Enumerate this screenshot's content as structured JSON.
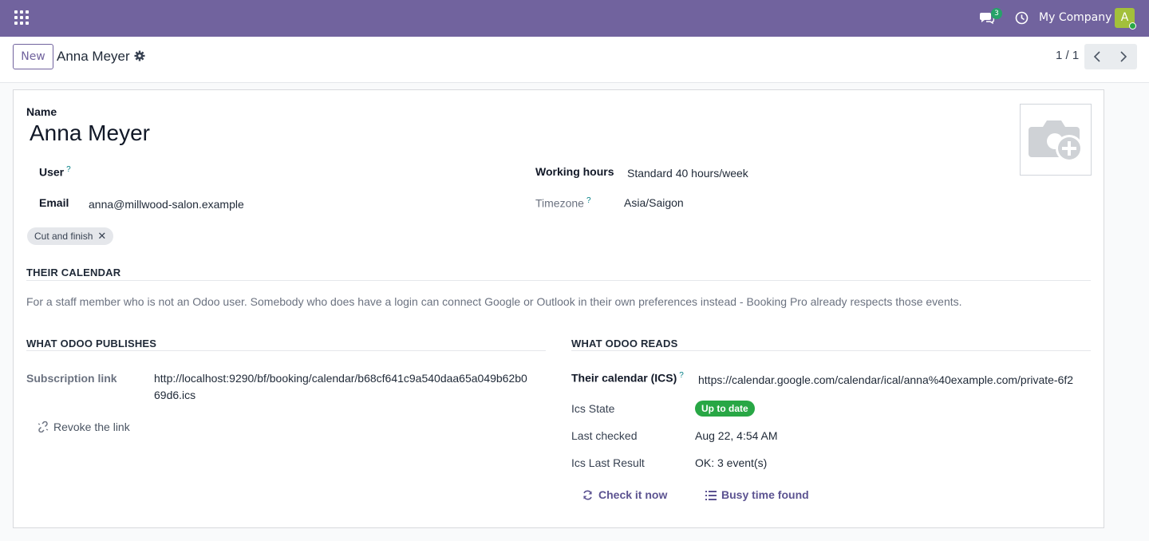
{
  "navbar": {
    "company": "My Company",
    "chat_count": "3",
    "avatar_letter": "A",
    "icons": [
      "apps-icon",
      "chat-icon",
      "clock-icon"
    ]
  },
  "control_panel": {
    "new_label": "New",
    "breadcrumb": "Anna Meyer",
    "pager": "1 / 1"
  },
  "form": {
    "name_label": "Name",
    "name_value": "Anna Meyer",
    "user_label": "User",
    "user_help": "?",
    "email_label": "Email",
    "email_value": "anna@millwood-salon.example",
    "working_hours_label": "Working hours",
    "working_hours_value": "Standard 40 hours/week",
    "timezone_label": "Timezone",
    "timezone_help": "?",
    "timezone_value": "Asia/Saigon",
    "tags": [
      "Cut and finish"
    ],
    "tag_remove": "✕"
  },
  "calendar_section": {
    "title": "THEIR CALENDAR",
    "description": "For a staff member who is not an Odoo user. Somebody who does have a login can connect Google or Outlook in their own preferences instead - Booking Pro already respects those events."
  },
  "publishes": {
    "title": "WHAT ODOO PUBLISHES",
    "subscription_label": "Subscription link",
    "subscription_line1": "http://localhost:9290/bf/booking/calendar/b68cf641c9a540daa65a049b62b0",
    "subscription_line2": "69d6.ics",
    "revoke_label": "Revoke the link"
  },
  "reads": {
    "title": "WHAT ODOO READS",
    "ics_label": "Their calendar (ICS)",
    "ics_help": "?",
    "ics_value": "https://calendar.google.com/calendar/ical/anna%40example.com/private-6f2",
    "state_label": "Ics State",
    "state_value": "Up to date",
    "last_checked_label": "Last checked",
    "last_checked_value": "Aug 22, 4:54 AM",
    "last_result_label": "Ics Last Result",
    "last_result_value": "OK: 3 event(s)",
    "check_now_label": "Check it now",
    "busy_label": "Busy time found"
  },
  "colors": {
    "brand": "#71639e",
    "success": "#28a745",
    "link": "#5c5391"
  }
}
